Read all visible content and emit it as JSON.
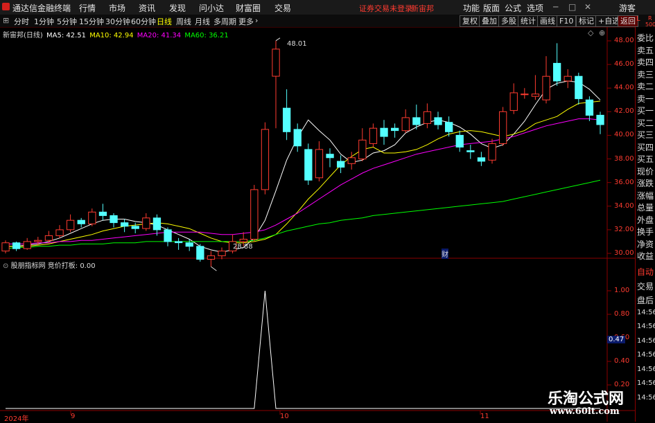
{
  "menubar": {
    "app_name": "通达信金融终端",
    "items": [
      "行情",
      "市场",
      "资讯",
      "发现",
      "问小达",
      "财富圈",
      "交易"
    ],
    "login_notice": "证券交易未登录",
    "stock_name": "新宙邦",
    "right_items": [
      "功能",
      "版面",
      "公式",
      "选项"
    ],
    "guest": "游客"
  },
  "toolbar": {
    "periods": [
      "分时",
      "1分钟",
      "5分钟",
      "15分钟",
      "30分钟",
      "60分钟",
      "日线",
      "周线",
      "月线",
      "多周期",
      "更多"
    ],
    "active": "日线",
    "right_buttons": [
      "复权",
      "叠加",
      "多股",
      "统计",
      "画线",
      "F10",
      "标记",
      "+自选",
      "返回"
    ]
  },
  "main_panel": {
    "title": "新宙邦(日线)",
    "ma": [
      {
        "label": "MA5: 42.51",
        "color": "#ffffff"
      },
      {
        "label": "MA10: 42.94",
        "color": "#ffff00"
      },
      {
        "label": "MA20: 41.34",
        "color": "#ff00ff"
      },
      {
        "label": "MA60: 36.21",
        "color": "#00ff00"
      }
    ],
    "high_label": "48.01",
    "low_label": "28.88",
    "finance_marker": "财"
  },
  "sub_panel": {
    "title": "股朋指标网",
    "indicator": "竞价打板: 0.00",
    "current_value": "0.47"
  },
  "right_col": {
    "L": "L",
    "R": "R",
    "num": "500",
    "items": [
      "委比",
      "卖五",
      "卖四",
      "卖三",
      "卖二",
      "卖一",
      "买一",
      "买二",
      "买三",
      "买四",
      "买五",
      "现价",
      "涨跌",
      "涨幅",
      "总量",
      "外盘",
      "换手",
      "净资",
      "收益"
    ],
    "lower_items": [
      "自动",
      "交易",
      "盘后",
      "14:56",
      "14:56",
      "14:56",
      "14:56",
      "14:56",
      "14:56",
      "14:56"
    ]
  },
  "x_labels": [
    "2024年",
    "9",
    "10",
    "11"
  ],
  "watermark": {
    "line1": "乐淘公式网",
    "line2": "www.60lt.com"
  },
  "chart_data": [
    {
      "type": "candlestick",
      "y_ticks": [
        48,
        46,
        44,
        42,
        40,
        38,
        36,
        34,
        32,
        30
      ],
      "y_labels": [
        "48.00",
        "46.00",
        "44.00",
        "42.00",
        "40.00",
        "38.00",
        "36.00",
        "34.00",
        "32.00",
        "30.00"
      ],
      "ylim": [
        29,
        49
      ],
      "candles": [
        {
          "o": 30.2,
          "c": 30.9,
          "h": 31.1,
          "l": 30.0
        },
        {
          "o": 30.9,
          "c": 30.4,
          "h": 31.0,
          "l": 30.2
        },
        {
          "o": 30.4,
          "c": 31.0,
          "h": 31.3,
          "l": 30.3
        },
        {
          "o": 31.0,
          "c": 31.1,
          "h": 31.4,
          "l": 30.7
        },
        {
          "o": 31.1,
          "c": 31.5,
          "h": 31.9,
          "l": 30.9
        },
        {
          "o": 31.5,
          "c": 32.0,
          "h": 32.4,
          "l": 31.3
        },
        {
          "o": 32.0,
          "c": 32.8,
          "h": 33.3,
          "l": 31.8
        },
        {
          "o": 32.8,
          "c": 32.5,
          "h": 33.0,
          "l": 32.2
        },
        {
          "o": 32.5,
          "c": 33.5,
          "h": 33.8,
          "l": 32.3
        },
        {
          "o": 33.5,
          "c": 33.2,
          "h": 34.2,
          "l": 32.8
        },
        {
          "o": 33.2,
          "c": 32.6,
          "h": 33.4,
          "l": 32.2
        },
        {
          "o": 32.6,
          "c": 32.3,
          "h": 32.9,
          "l": 31.8
        },
        {
          "o": 32.3,
          "c": 32.1,
          "h": 32.6,
          "l": 31.7
        },
        {
          "o": 32.1,
          "c": 33.0,
          "h": 33.4,
          "l": 31.9
        },
        {
          "o": 33.0,
          "c": 32.0,
          "h": 33.3,
          "l": 31.5
        },
        {
          "o": 32.0,
          "c": 31.0,
          "h": 32.2,
          "l": 30.6
        },
        {
          "o": 31.0,
          "c": 30.9,
          "h": 31.3,
          "l": 30.3
        },
        {
          "o": 30.9,
          "c": 30.6,
          "h": 31.2,
          "l": 30.2
        },
        {
          "o": 30.6,
          "c": 29.5,
          "h": 30.8,
          "l": 29.3
        },
        {
          "o": 29.5,
          "c": 29.8,
          "h": 30.2,
          "l": 28.88
        },
        {
          "o": 29.8,
          "c": 30.2,
          "h": 30.5,
          "l": 29.5
        },
        {
          "o": 30.2,
          "c": 31.0,
          "h": 31.6,
          "l": 30.0
        },
        {
          "o": 31.0,
          "c": 31.2,
          "h": 31.8,
          "l": 30.6
        },
        {
          "o": 31.2,
          "c": 35.4,
          "h": 35.8,
          "l": 31.0
        },
        {
          "o": 35.4,
          "c": 40.5,
          "h": 41.1,
          "l": 35.0
        },
        {
          "o": 45.0,
          "c": 47.3,
          "h": 48.01,
          "l": 40.6
        },
        {
          "o": 42.3,
          "c": 40.3,
          "h": 43.9,
          "l": 39.6
        },
        {
          "o": 40.5,
          "c": 39.1,
          "h": 41.0,
          "l": 38.6
        },
        {
          "o": 38.8,
          "c": 36.2,
          "h": 39.3,
          "l": 35.8
        },
        {
          "o": 36.4,
          "c": 38.8,
          "h": 39.5,
          "l": 36.1
        },
        {
          "o": 38.4,
          "c": 38.1,
          "h": 38.9,
          "l": 37.3
        },
        {
          "o": 37.8,
          "c": 37.3,
          "h": 38.3,
          "l": 36.8
        },
        {
          "o": 37.6,
          "c": 38.1,
          "h": 38.6,
          "l": 37.1
        },
        {
          "o": 38.0,
          "c": 39.6,
          "h": 40.6,
          "l": 37.8
        },
        {
          "o": 39.3,
          "c": 40.6,
          "h": 41.0,
          "l": 39.0
        },
        {
          "o": 40.6,
          "c": 39.9,
          "h": 41.3,
          "l": 39.2
        },
        {
          "o": 40.6,
          "c": 40.4,
          "h": 41.0,
          "l": 39.8
        },
        {
          "o": 40.4,
          "c": 41.5,
          "h": 42.2,
          "l": 40.2
        },
        {
          "o": 41.5,
          "c": 40.9,
          "h": 42.6,
          "l": 40.5
        },
        {
          "o": 41.0,
          "c": 42.0,
          "h": 42.7,
          "l": 40.6
        },
        {
          "o": 41.5,
          "c": 40.9,
          "h": 42.0,
          "l": 40.5
        },
        {
          "o": 41.1,
          "c": 40.3,
          "h": 41.6,
          "l": 39.9
        },
        {
          "o": 40.0,
          "c": 39.0,
          "h": 40.4,
          "l": 38.6
        },
        {
          "o": 38.7,
          "c": 38.6,
          "h": 39.2,
          "l": 38.0
        },
        {
          "o": 38.1,
          "c": 37.8,
          "h": 38.6,
          "l": 37.4
        },
        {
          "o": 37.9,
          "c": 39.3,
          "h": 39.7,
          "l": 37.6
        },
        {
          "o": 39.3,
          "c": 42.0,
          "h": 42.4,
          "l": 39.1
        },
        {
          "o": 42.1,
          "c": 43.6,
          "h": 44.4,
          "l": 41.8
        },
        {
          "o": 43.5,
          "c": 43.5,
          "h": 44.0,
          "l": 43.1
        },
        {
          "o": 43.3,
          "c": 43.5,
          "h": 45.1,
          "l": 43.0
        },
        {
          "o": 43.0,
          "c": 45.0,
          "h": 46.7,
          "l": 42.7
        },
        {
          "o": 46.1,
          "c": 44.6,
          "h": 47.8,
          "l": 44.2
        },
        {
          "o": 44.6,
          "c": 45.0,
          "h": 45.6,
          "l": 44.0
        },
        {
          "o": 45.0,
          "c": 43.1,
          "h": 45.3,
          "l": 42.6
        },
        {
          "o": 43.0,
          "c": 41.7,
          "h": 43.3,
          "l": 41.2
        },
        {
          "o": 41.7,
          "c": 40.9,
          "h": 42.0,
          "l": 40.1
        }
      ],
      "ma": [
        {
          "name": "MA5",
          "color": "#ffffff",
          "values": [
            30.6,
            30.6,
            30.7,
            30.8,
            31.0,
            31.3,
            31.7,
            32.1,
            32.5,
            32.8,
            32.9,
            32.9,
            32.7,
            32.6,
            32.4,
            32.0,
            31.6,
            31.2,
            30.6,
            30.3,
            30.1,
            30.3,
            30.5,
            31.3,
            32.8,
            35.3,
            37.9,
            39.8,
            41.3,
            40.4,
            39.6,
            38.4,
            37.7,
            37.9,
            38.5,
            38.7,
            39.2,
            40.2,
            40.7,
            41.1,
            41.3,
            41.1,
            40.7,
            40.1,
            39.3,
            38.9,
            39.2,
            40.1,
            41.2,
            42.6,
            43.9,
            44.4,
            44.6,
            44.5,
            43.9,
            43.0
          ]
        },
        {
          "name": "MA10",
          "color": "#ffff00",
          "values": [
            30.6,
            30.6,
            30.6,
            30.7,
            30.8,
            31.0,
            31.2,
            31.4,
            31.6,
            31.9,
            32.1,
            32.3,
            32.4,
            32.5,
            32.6,
            32.5,
            32.3,
            32.1,
            31.7,
            31.3,
            31.0,
            30.9,
            30.9,
            31.0,
            31.2,
            31.6,
            32.5,
            33.5,
            34.6,
            35.5,
            36.5,
            37.5,
            38.2,
            38.8,
            39.0,
            38.5,
            38.5,
            38.6,
            38.8,
            39.2,
            39.7,
            40.1,
            40.3,
            40.4,
            40.3,
            40.1,
            39.9,
            40.1,
            40.4,
            41.0,
            41.3,
            41.6,
            42.2,
            42.7,
            42.8,
            42.9
          ]
        },
        {
          "name": "MA20",
          "color": "#ff00ff",
          "values": [
            30.8,
            30.8,
            30.8,
            30.9,
            30.9,
            31.0,
            31.0,
            31.1,
            31.1,
            31.2,
            31.3,
            31.4,
            31.5,
            31.6,
            31.7,
            31.8,
            31.8,
            31.8,
            31.8,
            31.7,
            31.6,
            31.6,
            31.7,
            31.8,
            32.0,
            32.4,
            32.9,
            33.4,
            34.0,
            34.6,
            35.2,
            35.8,
            36.3,
            36.8,
            37.2,
            37.5,
            37.8,
            38.1,
            38.4,
            38.6,
            38.8,
            39.0,
            39.2,
            39.3,
            39.4,
            39.5,
            39.7,
            39.9,
            40.2,
            40.5,
            40.8,
            41.0,
            41.2,
            41.4,
            41.4,
            41.3
          ]
        },
        {
          "name": "MA60",
          "color": "#00ff00",
          "values": [
            30.4,
            30.5,
            30.5,
            30.6,
            30.6,
            30.7,
            30.7,
            30.8,
            30.8,
            30.8,
            30.9,
            30.9,
            30.9,
            31.0,
            31.0,
            31.0,
            31.0,
            31.0,
            31.0,
            31.0,
            31.0,
            31.0,
            31.0,
            31.1,
            31.3,
            31.6,
            31.9,
            32.1,
            32.3,
            32.5,
            32.6,
            32.8,
            32.9,
            33.0,
            33.2,
            33.3,
            33.4,
            33.5,
            33.6,
            33.7,
            33.8,
            33.9,
            34.0,
            34.1,
            34.2,
            34.3,
            34.4,
            34.6,
            34.8,
            35.0,
            35.2,
            35.4,
            35.6,
            35.8,
            36.0,
            36.2
          ]
        }
      ]
    },
    {
      "type": "line",
      "y_labels": [
        "1.00",
        "0.80",
        "0.60",
        "0.40",
        "0.20"
      ],
      "y_ticks": [
        1.0,
        0.8,
        0.6,
        0.4,
        0.2
      ],
      "ylim": [
        0,
        1.0
      ],
      "series": [
        {
          "color": "#ffffff",
          "values": [
            0,
            0,
            0,
            0,
            0,
            0,
            0,
            0,
            0,
            0,
            0,
            0,
            0,
            0,
            0,
            0,
            0,
            0,
            0,
            0,
            0,
            0,
            0,
            0,
            1,
            0,
            0,
            0,
            0,
            0,
            0,
            0,
            0,
            0,
            0,
            0,
            0,
            0,
            0,
            0,
            0,
            0,
            0,
            0,
            0,
            0,
            0,
            0,
            0,
            0,
            0,
            0,
            0,
            0,
            0,
            0
          ]
        }
      ]
    }
  ]
}
